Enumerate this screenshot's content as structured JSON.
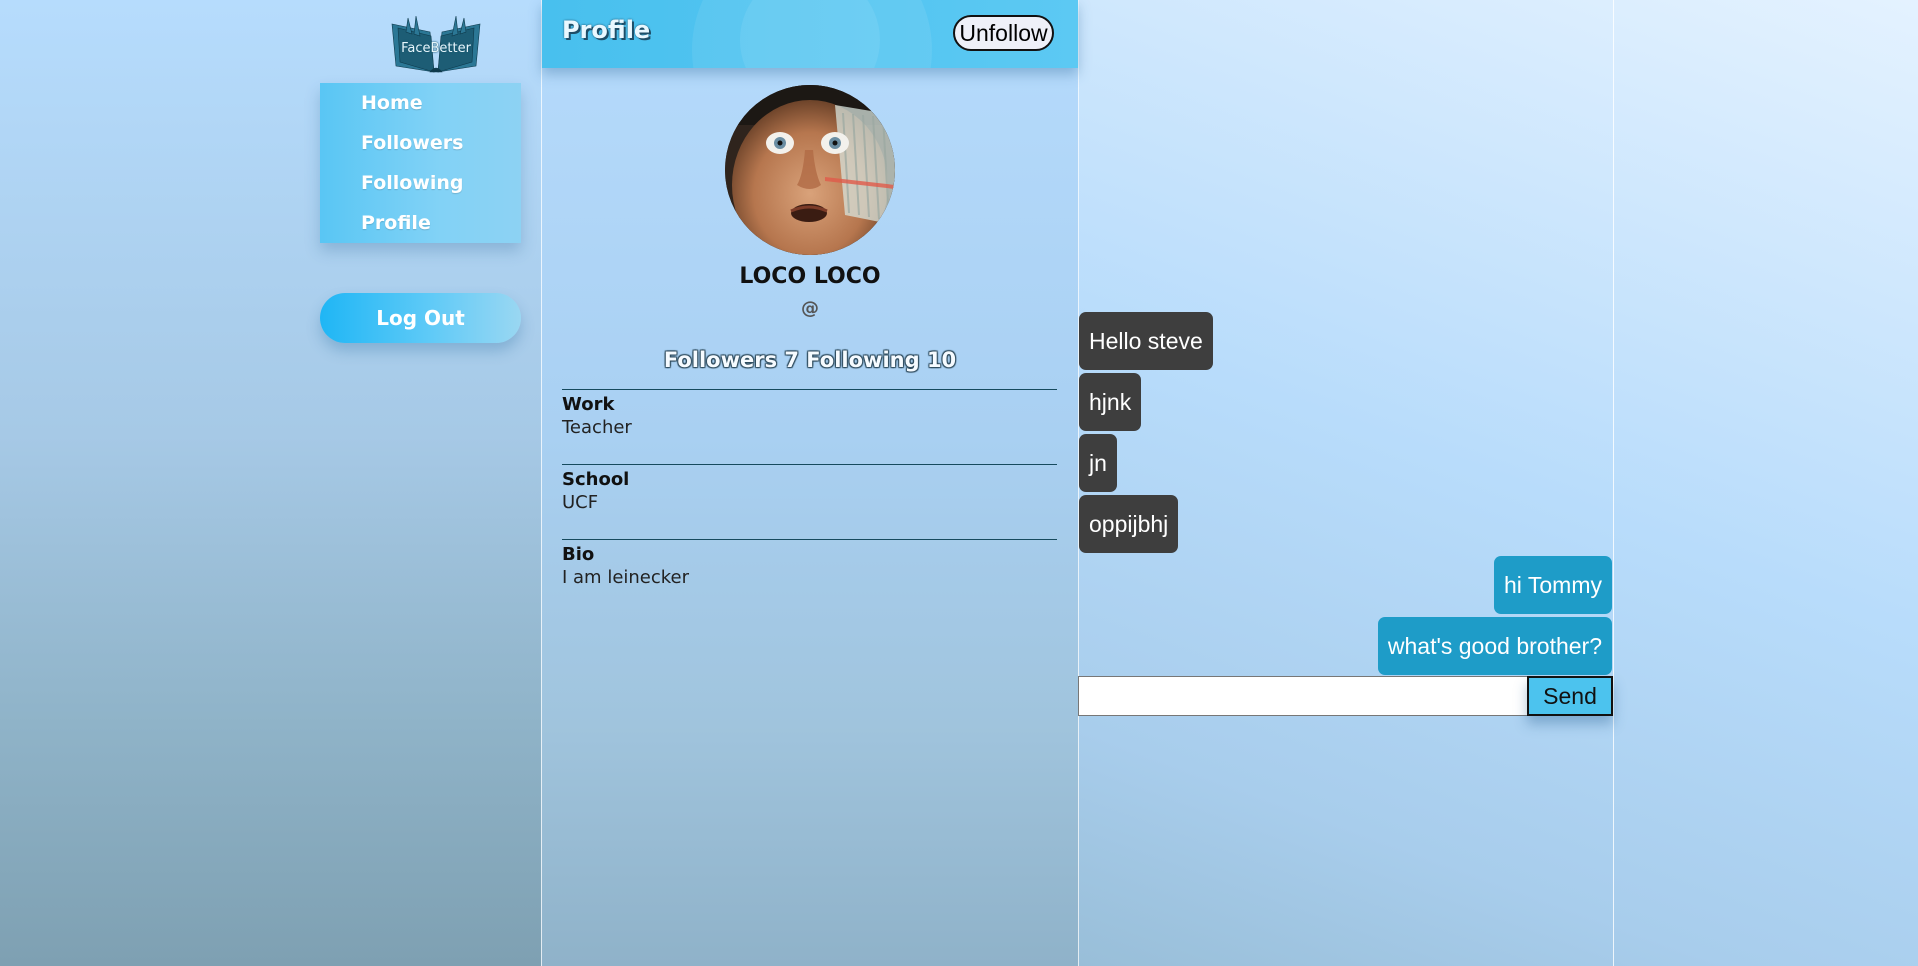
{
  "app": {
    "logo_text": "FaceBetter"
  },
  "sidebar": {
    "items": [
      {
        "label": "Home"
      },
      {
        "label": "Followers"
      },
      {
        "label": "Following"
      },
      {
        "label": "Profile"
      }
    ],
    "logout_label": "Log Out"
  },
  "profile": {
    "header_title": "Profile",
    "unfollow_label": "Unfollow",
    "name": "LOCO LOCO",
    "handle": "@",
    "stats": "Followers 7 Following 10",
    "sections": [
      {
        "label": "Work",
        "value": "Teacher"
      },
      {
        "label": "School",
        "value": "UCF"
      },
      {
        "label": "Bio",
        "value": "I am leinecker"
      }
    ]
  },
  "chat": {
    "messages": [
      {
        "text": "Hello steve",
        "direction": "incoming"
      },
      {
        "text": "hjnk",
        "direction": "incoming"
      },
      {
        "text": "jn",
        "direction": "incoming"
      },
      {
        "text": "oppijbhj",
        "direction": "incoming"
      },
      {
        "text": "hi Tommy",
        "direction": "outgoing"
      },
      {
        "text": "what's good brother?",
        "direction": "outgoing"
      }
    ],
    "input_value": "",
    "send_label": "Send"
  },
  "colors": {
    "nav_item": "#59c6f4",
    "logout": "#1fb6f5",
    "header": "#48c0ee",
    "incoming_bubble": "#3e3e3e",
    "outgoing_bubble": "#1e9cc8",
    "send_button": "#4cc3ee"
  },
  "icons": {
    "logo": "open-book-logo-icon"
  }
}
